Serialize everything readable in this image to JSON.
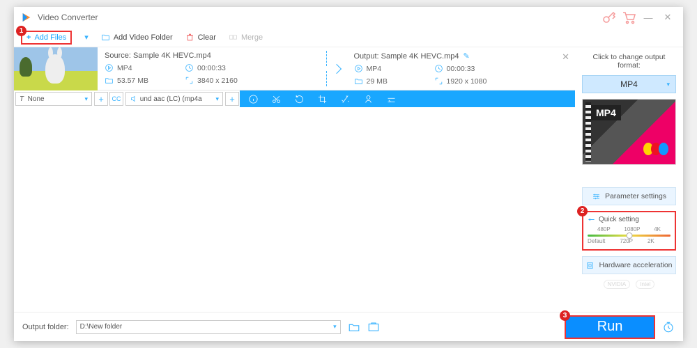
{
  "window": {
    "title": "Video Converter"
  },
  "toolbar": {
    "add_files": "Add Files",
    "add_folder": "Add Video Folder",
    "clear": "Clear",
    "merge": "Merge"
  },
  "badges": {
    "one": "1",
    "two": "2",
    "three": "3"
  },
  "item": {
    "source_label": "Source: Sample 4K HEVC.mp4",
    "output_label": "Output: Sample 4K HEVC.mp4",
    "src": {
      "format": "MP4",
      "duration": "00:00:33",
      "size": "53.57 MB",
      "resolution": "3840 x 2160"
    },
    "out": {
      "format": "MP4",
      "duration": "00:00:33",
      "size": "29 MB",
      "resolution": "1920 x 1080"
    }
  },
  "subtitle": {
    "none": "None",
    "audio_track": "und aac (LC) (mp4a"
  },
  "side": {
    "title": "Click to change output format:",
    "format": "MP4",
    "preview_label": "MP4",
    "param_settings": "Parameter settings",
    "quick_title": "Quick setting",
    "scale": {
      "p480": "480P",
      "p720": "720P",
      "p1080": "1080P",
      "k2": "2K",
      "k4": "4K",
      "default": "Default"
    },
    "hw_accel": "Hardware acceleration",
    "nvidia": "NVIDIA",
    "intel": "Intel"
  },
  "footer": {
    "label": "Output folder:",
    "path": "D:\\New folder",
    "run": "Run"
  }
}
